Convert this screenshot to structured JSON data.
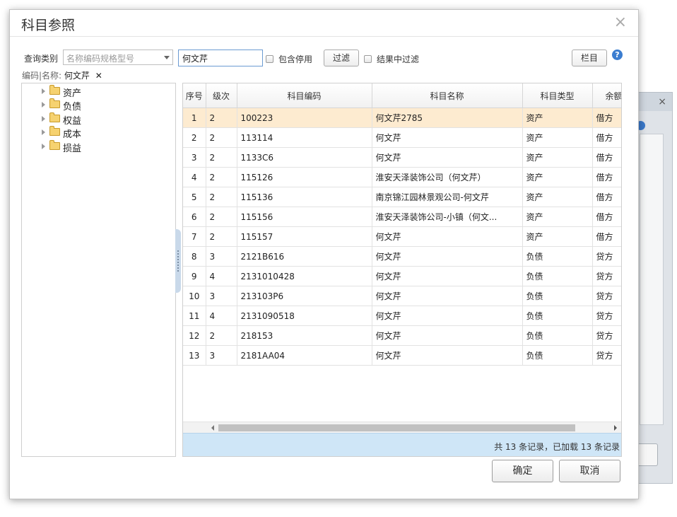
{
  "dialog": {
    "title": "科目参照",
    "close_glyph": "×"
  },
  "query": {
    "category_label": "查询类别",
    "category_placeholder": "名称编码规格型号",
    "search_value": "何文芹",
    "include_disabled_label": "包含停用",
    "filter_button": "过滤",
    "filter_in_results_label": "结果中过滤",
    "columns_button": "栏目",
    "help_glyph": "?"
  },
  "breadcrumb": {
    "prefix": "编码|名称:",
    "value": "何文芹",
    "remove_glyph": "✕"
  },
  "tree": {
    "items": [
      {
        "label": "资产"
      },
      {
        "label": "负债"
      },
      {
        "label": "权益"
      },
      {
        "label": "成本"
      },
      {
        "label": "损益"
      }
    ]
  },
  "grid": {
    "columns": [
      "序号",
      "级次",
      "科目编码",
      "科目名称",
      "科目类型",
      "余额"
    ],
    "rows": [
      {
        "no": "1",
        "level": "2",
        "code": "100223",
        "name": "何文芹2785",
        "type": "资产",
        "balance": "借方",
        "selected": true
      },
      {
        "no": "2",
        "level": "2",
        "code": "113114",
        "name": "何文芹",
        "type": "资产",
        "balance": "借方"
      },
      {
        "no": "3",
        "level": "2",
        "code": "1133C6",
        "name": "何文芹",
        "type": "资产",
        "balance": "借方"
      },
      {
        "no": "4",
        "level": "2",
        "code": "115126",
        "name": "淮安天泽装饰公司（何文芹）",
        "type": "资产",
        "balance": "借方"
      },
      {
        "no": "5",
        "level": "2",
        "code": "115136",
        "name": "南京锦江园林景观公司-何文芹",
        "type": "资产",
        "balance": "借方"
      },
      {
        "no": "6",
        "level": "2",
        "code": "115156",
        "name": "淮安天泽装饰公司-小镇（何文...",
        "type": "资产",
        "balance": "借方"
      },
      {
        "no": "7",
        "level": "2",
        "code": "115157",
        "name": "何文芹",
        "type": "资产",
        "balance": "借方"
      },
      {
        "no": "8",
        "level": "3",
        "code": "2121B616",
        "name": "何文芹",
        "type": "负债",
        "balance": "贷方"
      },
      {
        "no": "9",
        "level": "4",
        "code": "2131010428",
        "name": "何文芹",
        "type": "负债",
        "balance": "贷方"
      },
      {
        "no": "10",
        "level": "3",
        "code": "213103P6",
        "name": "何文芹",
        "type": "负债",
        "balance": "贷方"
      },
      {
        "no": "11",
        "level": "4",
        "code": "2131090518",
        "name": "何文芹",
        "type": "负债",
        "balance": "贷方"
      },
      {
        "no": "12",
        "level": "2",
        "code": "218153",
        "name": "何文芹",
        "type": "负债",
        "balance": "贷方"
      },
      {
        "no": "13",
        "level": "3",
        "code": "2181AA04",
        "name": "何文芹",
        "type": "负债",
        "balance": "贷方"
      }
    ],
    "status": "共 13 条记录，已加载 13 条记录"
  },
  "footer": {
    "confirm_button": "确定",
    "cancel_button": "取消"
  },
  "background_dialog": {
    "close_glyph": "×"
  },
  "colors": {
    "selected_row": "#fdebd0",
    "status_bar": "#cfe6f7",
    "help_icon": "#3b7dd0"
  }
}
